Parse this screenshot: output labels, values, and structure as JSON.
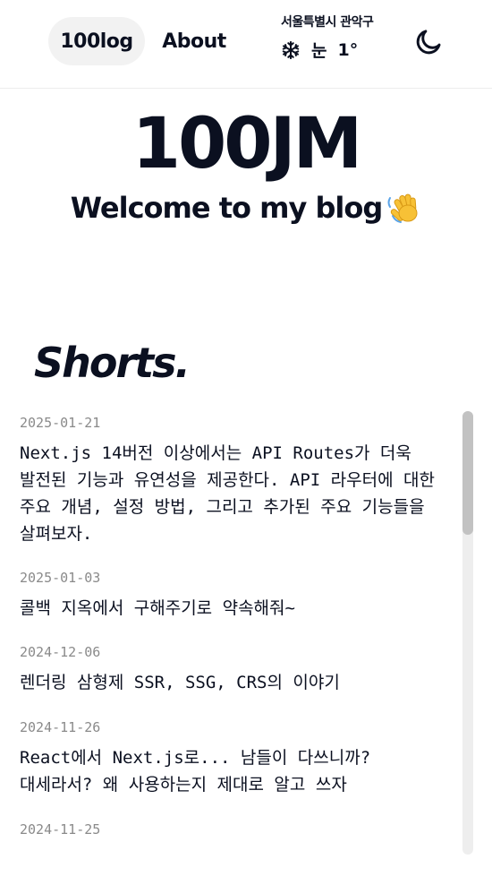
{
  "nav": {
    "home_label": "100log",
    "about_label": "About"
  },
  "weather": {
    "location": "서울특별시 관악구",
    "icon": "snowflake-icon",
    "condition": "눈",
    "temperature": "1°"
  },
  "theme_toggle": {
    "icon": "moon-icon"
  },
  "hero": {
    "title": "100JM",
    "welcome": "Welcome to my blog",
    "welcome_icon": "waving-hand-icon"
  },
  "shorts": {
    "section_title": "Shorts.",
    "items": [
      {
        "date": "2025-01-21",
        "text": "Next.js 14버전 이상에서는 API Routes가 더욱 발전된 기능과 유연성을 제공한다. API 라우터에 대한 주요 개념, 설정 방법, 그리고 추가된 주요 기능들을 살펴보자."
      },
      {
        "date": "2025-01-03",
        "text": "콜백 지옥에서 구해주기로 약속해줘~"
      },
      {
        "date": "2024-12-06",
        "text": "렌더링 삼형제 SSR, SSG, CRS의 이야기"
      },
      {
        "date": "2024-11-26",
        "text": "React에서 Next.js로... 남들이 다쓰니까?\n대세라서? 왜 사용하는지 제대로 알고 쓰자"
      },
      {
        "date": "2024-11-25",
        "text": ""
      }
    ]
  },
  "colors": {
    "text": "#0b1020",
    "date": "#8a8a8a",
    "nav_active_bg": "#f2f2f2",
    "scroll_track": "#eeeeee",
    "scroll_thumb": "#c2c2c2"
  }
}
